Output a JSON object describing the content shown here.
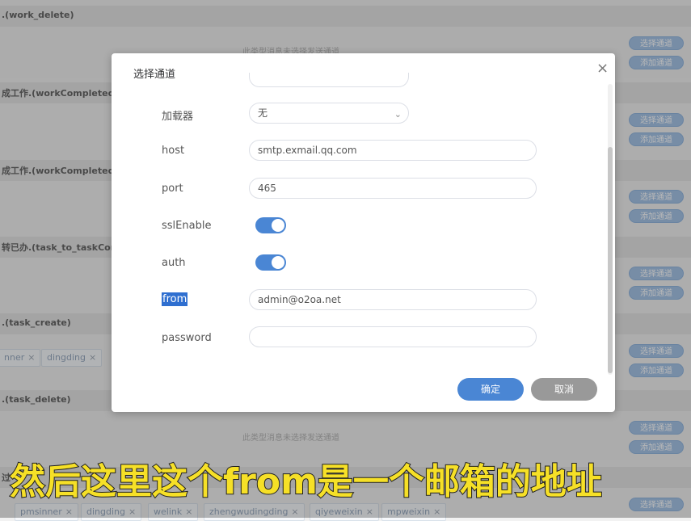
{
  "background": {
    "sections": [
      {
        "title": ".(work_delete)",
        "empty_note": "此类型消息未选择发送通道"
      },
      {
        "title": "成工作.(workCompleted_cr"
      },
      {
        "title": "成工作.(workCompleted_de"
      },
      {
        "title": "转已办.(task_to_taskCompl"
      },
      {
        "title": ".(task_create)"
      },
      {
        "title": ".(task_delete)",
        "empty_note": "此类型消息未选择发送通道"
      },
      {
        "title": "过"
      }
    ],
    "select_channel_label": "选择通道",
    "add_channel_label": "添加通道",
    "tags_row1": [
      {
        "label": "nner",
        "close": "×"
      },
      {
        "label": "dingding",
        "close": "×"
      }
    ],
    "tags_row2": [
      {
        "label": "pmsinner",
        "close": "×"
      },
      {
        "label": "dingding",
        "close": "×"
      },
      {
        "label": "welink",
        "close": "×"
      },
      {
        "label": "zhengwudingding",
        "close": "×"
      },
      {
        "label": "qiyeweixin",
        "close": "×"
      },
      {
        "label": "mpweixin",
        "close": "×"
      }
    ]
  },
  "modal": {
    "title": "选择通道",
    "close_icon": "×",
    "fields": {
      "encryptor": {
        "label": "加载器",
        "value": "无"
      },
      "host": {
        "label": "host",
        "value": "smtp.exmail.qq.com"
      },
      "port": {
        "label": "port",
        "value": "465"
      },
      "sslEnable": {
        "label": "sslEnable",
        "enabled": true
      },
      "auth": {
        "label": "auth",
        "enabled": true
      },
      "from": {
        "label": "from",
        "value": "admin@o2oa.net"
      },
      "password": {
        "label": "password",
        "value": ""
      }
    },
    "ok_label": "确定",
    "cancel_label": "取消"
  },
  "caption": "然后这里这个from是一个邮箱的地址",
  "colors": {
    "accent": "#4a86d4",
    "caption": "#f6e027"
  }
}
